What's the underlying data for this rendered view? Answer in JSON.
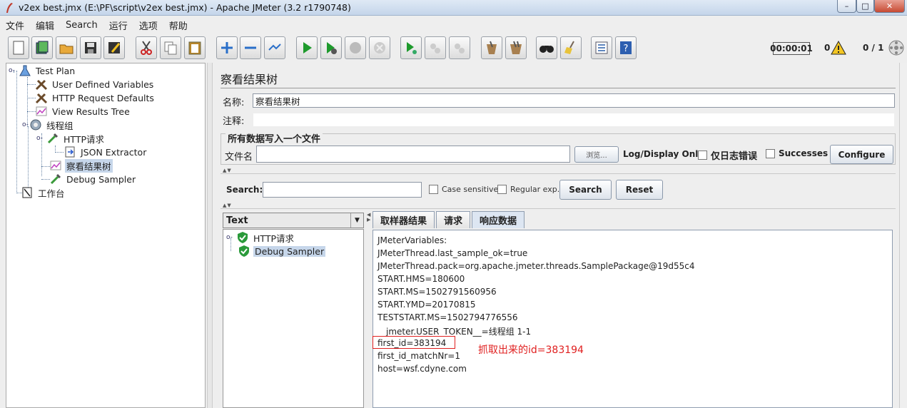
{
  "window": {
    "title": "v2ex best.jmx (E:\\PF\\script\\v2ex best.jmx) - Apache JMeter (3.2 r1790748)",
    "minimize": "–",
    "maximize": "□",
    "close": "✕"
  },
  "menu": [
    "文件",
    "编辑",
    "Search",
    "运行",
    "选项",
    "帮助"
  ],
  "toolbar": {
    "icons": [
      "new-icon",
      "templates-icon",
      "open-icon",
      "save-icon",
      "save-as-icon",
      "cut-icon",
      "copy-icon",
      "paste-icon",
      "expand-icon",
      "collapse-icon",
      "toggle-icon",
      "start-icon",
      "start-no-pause-icon",
      "stop-icon",
      "shutdown-icon",
      "remote-start-icon",
      "remote-stop-icon",
      "remote-shutdown-icon",
      "clear-icon",
      "clear-all-icon",
      "search-icon",
      "reset-search-icon",
      "function-helper-icon",
      "help-icon"
    ],
    "timer": "00:00:01",
    "error_count": "0",
    "threads": "0 / 1"
  },
  "tree": {
    "items": [
      {
        "label": "Test Plan"
      },
      {
        "label": "User Defined Variables"
      },
      {
        "label": "HTTP Request Defaults"
      },
      {
        "label": "View Results Tree"
      },
      {
        "label": "线程组"
      },
      {
        "label": "HTTP请求"
      },
      {
        "label": "JSON Extractor"
      },
      {
        "label": "察看结果树"
      },
      {
        "label": "Debug Sampler"
      },
      {
        "label": "工作台"
      }
    ]
  },
  "panel": {
    "title": "察看结果树",
    "name_label": "名称:",
    "name_value": "察看结果树",
    "comment_label": "注释:",
    "file_group_label": "所有数据写入一个文件",
    "file_label": "文件名",
    "file_value": "",
    "browse_label": "浏览...",
    "log_display_label": "Log/Display Only:",
    "errors_only_label": "仅日志错误",
    "successes_label": "Successes",
    "configure_label": "Configure"
  },
  "search": {
    "label": "Search:",
    "value": "",
    "case_sensitive_label": "Case sensitive",
    "regex_label": "Regular exp.",
    "search_button": "Search",
    "reset_button": "Reset"
  },
  "results": {
    "renderer": "Text",
    "samples": [
      {
        "label": "HTTP请求"
      },
      {
        "label": "Debug Sampler"
      }
    ],
    "tabs": [
      "取样器结果",
      "请求",
      "响应数据"
    ],
    "active_tab": "响应数据",
    "response_lines": [
      "JMeterVariables:",
      "JMeterThread.last_sample_ok=true",
      "JMeterThread.pack=org.apache.jmeter.threads.SamplePackage@19d55c4",
      "START.HMS=180600",
      "START.MS=1502791560956",
      "START.YMD=20170815",
      "TESTSTART.MS=1502794776556",
      "__jmeter.USER_TOKEN__=线程组 1-1",
      "first_id=383194",
      "first_id_matchNr=1",
      "host=wsf.cdyne.com"
    ],
    "annotation": "抓取出来的id=383194"
  }
}
